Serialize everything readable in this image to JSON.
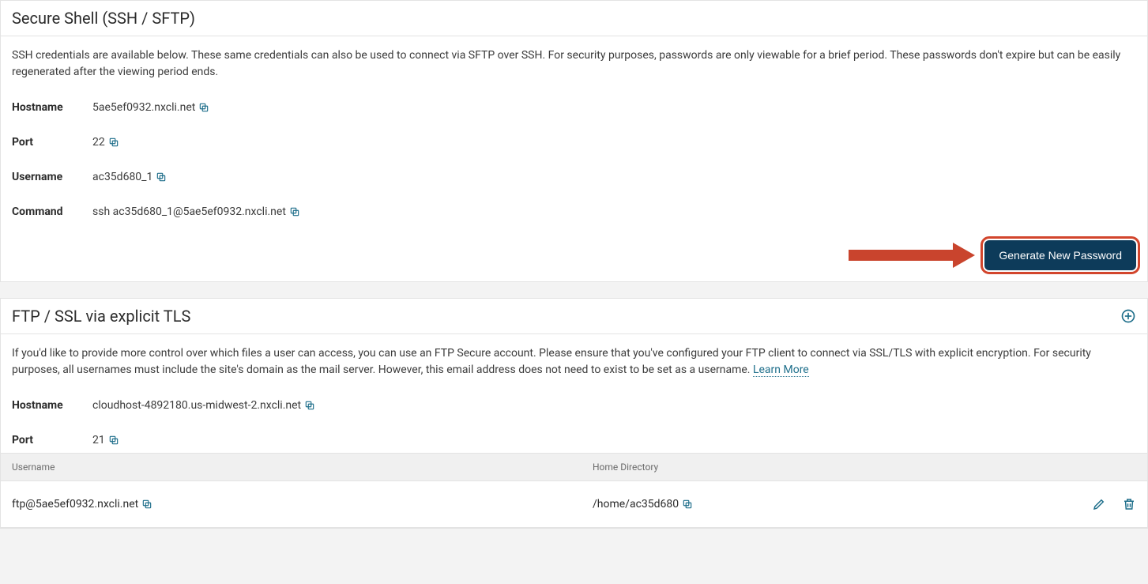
{
  "ssh": {
    "title": "Secure Shell (SSH / SFTP)",
    "description": "SSH credentials are available below. These same credentials can also be used to connect via SFTP over SSH. For security purposes, passwords are only viewable for a brief period. These passwords don't expire but can be easily regenerated after the viewing period ends.",
    "rows": {
      "hostname_label": "Hostname",
      "hostname_value": "5ae5ef0932.nxcli.net",
      "port_label": "Port",
      "port_value": "22",
      "username_label": "Username",
      "username_value": "ac35d680_1",
      "command_label": "Command",
      "command_value": "ssh ac35d680_1@5ae5ef0932.nxcli.net"
    },
    "button_label": "Generate New Password"
  },
  "ftp": {
    "title": "FTP / SSL via explicit TLS",
    "description": "If you'd like to provide more control over which files a user can access, you can use an FTP Secure account. Please ensure that you've configured your FTP client to connect via SSL/TLS with explicit encryption. For security purposes, all usernames must include the site's domain as the mail server. However, this email address does not need to exist to be set as a username. ",
    "learn_more": "Learn More",
    "rows": {
      "hostname_label": "Hostname",
      "hostname_value": "cloudhost-4892180.us-midwest-2.nxcli.net",
      "port_label": "Port",
      "port_value": "21"
    },
    "columns": {
      "username": "Username",
      "home": "Home Directory"
    },
    "account": {
      "username": "ftp@5ae5ef0932.nxcli.net",
      "home": "/home/ac35d680"
    }
  }
}
